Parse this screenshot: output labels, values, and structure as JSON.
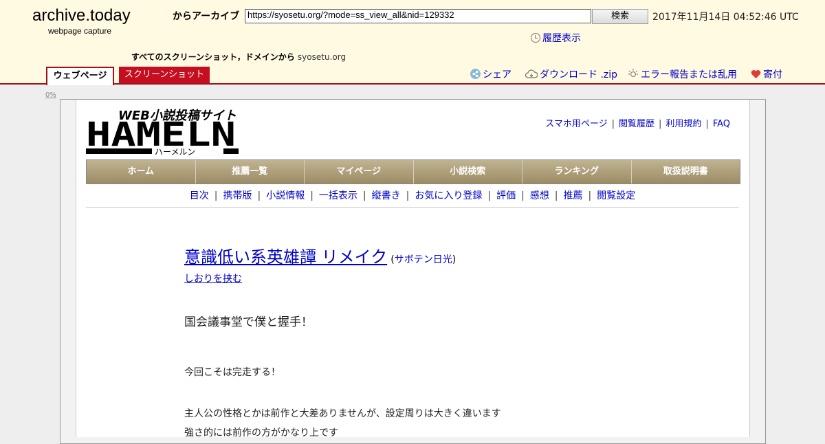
{
  "archive": {
    "title": "archive.today",
    "subtitle": "webpage capture",
    "archive_label": "からアーカイブ",
    "url_value": "https://syosetu.org/?mode=ss_view_all&nid=129332",
    "search_label": "検索",
    "timestamp": "2017年11月14日 04:52:46 UTC",
    "history_label": "履歴表示",
    "all_shots_label": "すべてのスクリーンショット，ドメインから",
    "domain_link": "syosetu.org",
    "tabs": {
      "webpage": "ウェブページ",
      "screenshot": "スクリーンショット"
    },
    "actions": {
      "share": "シェア",
      "download": "ダウンロード .zip",
      "report": "エラー報告または乱用",
      "donate": "寄付"
    },
    "progress_label": "0%",
    "colors": {
      "header_bg": "#fffae1",
      "accent": "#a0121e",
      "tab_red": "#c50e1f"
    }
  },
  "site": {
    "logo_text": "WEB小説投稿サイト",
    "logo_big": "HAMELN",
    "logo_kana": "ハーメルン",
    "top_links": [
      "スマホ用ページ",
      "閲覧履歴",
      "利用規約",
      "FAQ"
    ],
    "nav": [
      "ホーム",
      "推薦一覧",
      "マイページ",
      "小説検索",
      "ランキング",
      "取扱説明書"
    ],
    "subnav": [
      "目次",
      "携帯版",
      "小説情報",
      "一括表示",
      "縦書き",
      "お気に入り登録",
      "評価",
      "感想",
      "推薦",
      "閲覧設定"
    ]
  },
  "novel": {
    "title": "意識低い系英雄譚 リメイク",
    "author": "サボテン日光",
    "bookmark": "しおりを挟む",
    "subtitle": "国会議事堂で僕と握手！",
    "paragraphs": [
      "今回こそは完走する！",
      "主人公の性格とかは前作と大差ありませんが、設定周りは大きく違います",
      "強さ的には前作の方がかなり上です"
    ]
  }
}
